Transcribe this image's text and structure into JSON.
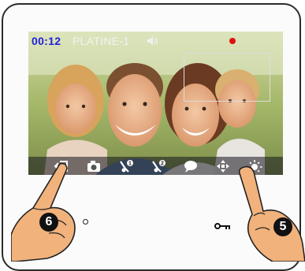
{
  "status_bar": {
    "time": "00:12",
    "station_name": "PLATINE-1",
    "speaker_icon": "speaker-muted-icon",
    "recording_indicator": "record-dot-icon",
    "recording_color": "#e01010",
    "time_color": "#1e1edc"
  },
  "toolbar": {
    "buttons": [
      {
        "icon": "back-arrow-icon"
      },
      {
        "icon": "camera-icon"
      },
      {
        "icon": "key-1-icon",
        "superscript": "1"
      },
      {
        "icon": "key-2-icon",
        "superscript": "2"
      },
      {
        "icon": "chat-bubble-icon"
      },
      {
        "icon": "direction-pad-icon"
      },
      {
        "icon": "brightness-icon"
      }
    ]
  },
  "callouts": {
    "left_number": "6",
    "right_number": "5"
  },
  "device": {
    "key_icon": "door-key-icon"
  }
}
